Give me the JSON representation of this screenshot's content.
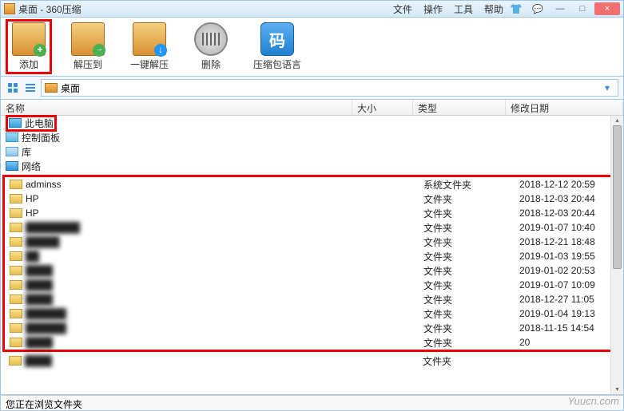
{
  "titlebar": {
    "title": "桌面 - 360压缩"
  },
  "menu": {
    "file": "文件",
    "operation": "操作",
    "tool": "工具",
    "help": "帮助"
  },
  "toolbar": {
    "add": "添加",
    "extract_to": "解压到",
    "one_click": "一键解压",
    "delete": "删除",
    "language": "压缩包语言"
  },
  "address": {
    "path": "桌面"
  },
  "columns": {
    "name": "名称",
    "size": "大小",
    "type": "类型",
    "date": "修改日期"
  },
  "tree": {
    "this_pc": "此电脑",
    "control_panel": "控制面板",
    "library": "库",
    "network": "网络"
  },
  "rows": [
    {
      "name": "adminss",
      "type": "系统文件夹",
      "date": "2018-12-12 20:59"
    },
    {
      "name": "HP",
      "type": "文件夹",
      "date": "2018-12-03 20:44"
    },
    {
      "name": "HP",
      "type": "文件夹",
      "date": "2018-12-03 20:44"
    },
    {
      "name": "████████",
      "blur": true,
      "type": "文件夹",
      "date": "2019-01-07 10:40"
    },
    {
      "name": "█████",
      "blur": true,
      "type": "文件夹",
      "date": "2018-12-21 18:48"
    },
    {
      "name": "██",
      "blur": true,
      "type": "文件夹",
      "date": "2019-01-03 19:55"
    },
    {
      "name": "████",
      "blur": true,
      "type": "文件夹",
      "date": "2019-01-02 20:53"
    },
    {
      "name": "████",
      "blur": true,
      "type": "文件夹",
      "date": "2019-01-07 10:09"
    },
    {
      "name": "████",
      "blur": true,
      "type": "文件夹",
      "date": "2018-12-27 11:05"
    },
    {
      "name": "██████",
      "blur": true,
      "type": "文件夹",
      "date": "2019-01-04 19:13"
    },
    {
      "name": "██████",
      "blur": true,
      "type": "文件夹",
      "date": "2018-11-15 14:54"
    },
    {
      "name": "████",
      "blur": true,
      "type": "文件夹",
      "date": "20"
    }
  ],
  "last_row_type": "文件夹",
  "statusbar": {
    "text": "您正在浏览文件夹"
  },
  "watermark": "Yuucn.com"
}
